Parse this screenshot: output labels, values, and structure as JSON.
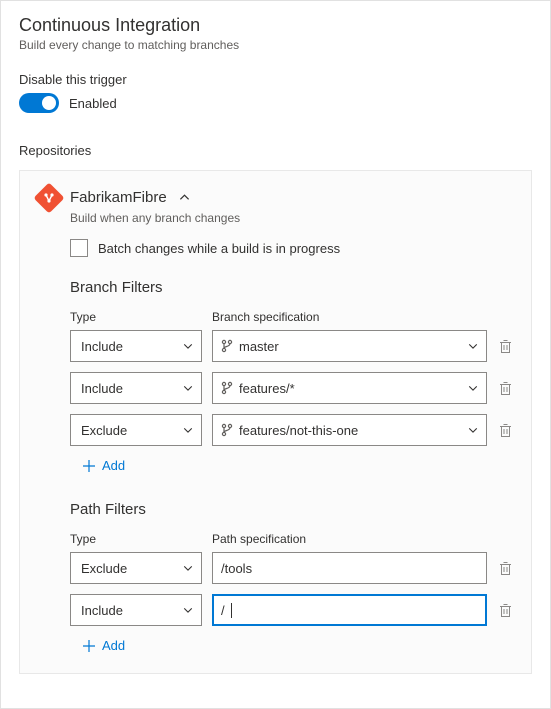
{
  "header": {
    "title": "Continuous Integration",
    "subtitle": "Build every change to matching branches"
  },
  "trigger": {
    "label": "Disable this trigger",
    "state_label": "Enabled"
  },
  "repositories": {
    "heading": "Repositories",
    "repo": {
      "name": "FabrikamFibre",
      "desc": "Build when any branch changes",
      "batch_label": "Batch changes while a build is in progress"
    }
  },
  "branch_filters": {
    "heading": "Branch Filters",
    "type_col": "Type",
    "spec_col": "Branch specification",
    "rows": [
      {
        "type": "Include",
        "spec": "master"
      },
      {
        "type": "Include",
        "spec": "features/*"
      },
      {
        "type": "Exclude",
        "spec": "features/not-this-one"
      }
    ],
    "add_label": "Add"
  },
  "path_filters": {
    "heading": "Path Filters",
    "type_col": "Type",
    "spec_col": "Path specification",
    "rows": [
      {
        "type": "Exclude",
        "spec": "/tools"
      },
      {
        "type": "Include",
        "spec": "/"
      }
    ],
    "add_label": "Add"
  }
}
